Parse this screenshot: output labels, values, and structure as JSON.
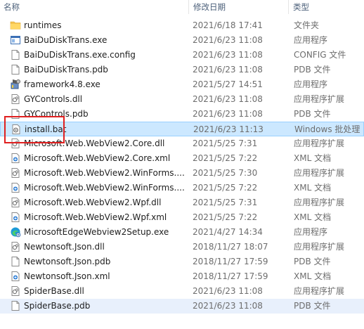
{
  "columns": {
    "name": "名称",
    "date": "修改日期",
    "type": "类型"
  },
  "files": [
    {
      "name": "runtimes",
      "date": "2021/6/18 17:41",
      "type": "文件夹",
      "icon": "folder-icon"
    },
    {
      "name": "BaiDuDiskTrans.exe",
      "date": "2021/6/23 11:08",
      "type": "应用程序",
      "icon": "exe-window-icon"
    },
    {
      "name": "BaiDuDiskTrans.exe.config",
      "date": "2021/6/23 11:08",
      "type": "CONFIG 文件",
      "icon": "document-icon"
    },
    {
      "name": "BaiDuDiskTrans.pdb",
      "date": "2021/6/23 11:08",
      "type": "PDB 文件",
      "icon": "document-icon"
    },
    {
      "name": "framework4.8.exe",
      "date": "2021/5/27 14:51",
      "type": "应用程序",
      "icon": "installer-icon"
    },
    {
      "name": "GYControls.dll",
      "date": "2021/6/23 11:08",
      "type": "应用程序扩展",
      "icon": "dll-icon"
    },
    {
      "name": "GYControls.pdb",
      "date": "2021/6/23 11:08",
      "type": "PDB 文件",
      "icon": "document-icon"
    },
    {
      "name": "install.bat",
      "date": "2021/6/23 11:13",
      "type": "Windows 批处理",
      "icon": "batch-file-icon",
      "selected": true
    },
    {
      "name": "Microsoft.Web.WebView2.Core.dll",
      "date": "2021/5/25 7:31",
      "type": "应用程序扩展",
      "icon": "dll-icon"
    },
    {
      "name": "Microsoft.Web.WebView2.Core.xml",
      "date": "2021/5/25 7:22",
      "type": "XML 文档",
      "icon": "xml-icon"
    },
    {
      "name": "Microsoft.Web.WebView2.WinForms....",
      "date": "2021/5/25 7:30",
      "type": "应用程序扩展",
      "icon": "dll-icon"
    },
    {
      "name": "Microsoft.Web.WebView2.WinForms....",
      "date": "2021/5/25 7:22",
      "type": "XML 文档",
      "icon": "xml-icon"
    },
    {
      "name": "Microsoft.Web.WebView2.Wpf.dll",
      "date": "2021/5/25 7:31",
      "type": "应用程序扩展",
      "icon": "dll-icon"
    },
    {
      "name": "Microsoft.Web.WebView2.Wpf.xml",
      "date": "2021/5/25 7:22",
      "type": "XML 文档",
      "icon": "xml-icon"
    },
    {
      "name": "MicrosoftEdgeWebview2Setup.exe",
      "date": "2021/4/27 14:34",
      "type": "应用程序",
      "icon": "edge-setup-icon"
    },
    {
      "name": "Newtonsoft.Json.dll",
      "date": "2018/11/27 18:07",
      "type": "应用程序扩展",
      "icon": "dll-icon"
    },
    {
      "name": "Newtonsoft.Json.pdb",
      "date": "2018/11/27 17:59",
      "type": "PDB 文件",
      "icon": "document-icon"
    },
    {
      "name": "Newtonsoft.Json.xml",
      "date": "2018/11/27 17:59",
      "type": "XML 文档",
      "icon": "xml-icon"
    },
    {
      "name": "SpiderBase.dll",
      "date": "2021/6/23 11:08",
      "type": "应用程序扩展",
      "icon": "dll-icon"
    },
    {
      "name": "SpiderBase.pdb",
      "date": "2021/6/23 11:08",
      "type": "PDB 文件",
      "icon": "document-icon",
      "hovered": true
    }
  ],
  "colors": {
    "selection": "#cce8ff",
    "selection_border": "#99d1ff",
    "annotation": "#e02020"
  }
}
